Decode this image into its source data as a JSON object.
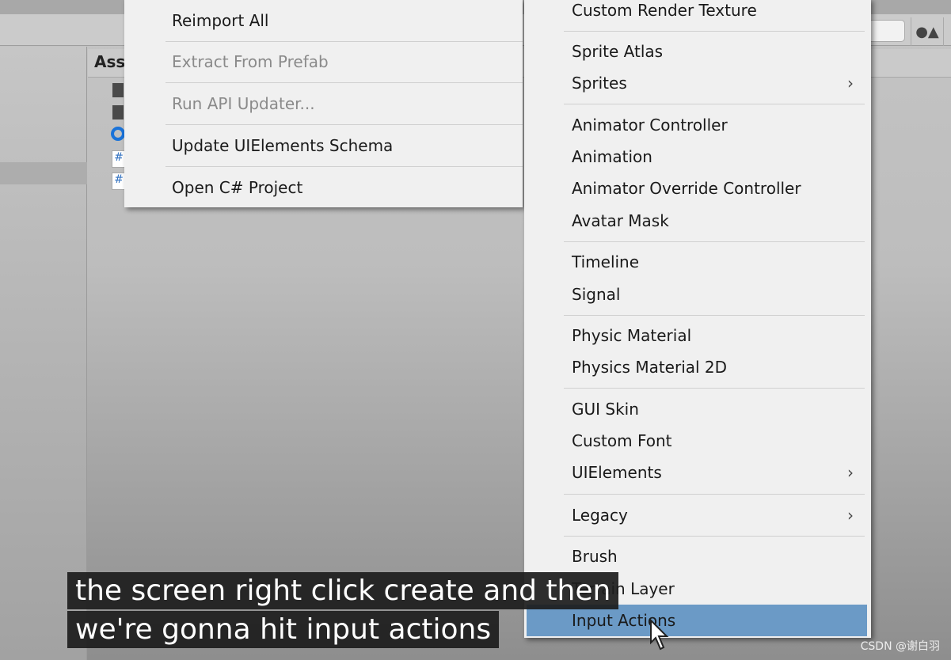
{
  "panel": {
    "assets_header": "Ass"
  },
  "left_menu": [
    {
      "label": "Reimport All",
      "disabled": false
    },
    {
      "label": "Extract From Prefab",
      "disabled": true
    },
    {
      "label": "Run API Updater...",
      "disabled": true
    },
    {
      "label": "Update UIElements Schema",
      "disabled": false
    },
    {
      "label": "Open C# Project",
      "disabled": false
    }
  ],
  "create_menu": [
    {
      "label": "Custom Render Texture"
    },
    {
      "label": "Sprite Atlas"
    },
    {
      "label": "Sprites",
      "submenu": true
    },
    {
      "label": "Animator Controller"
    },
    {
      "label": "Animation"
    },
    {
      "label": "Animator Override Controller"
    },
    {
      "label": "Avatar Mask"
    },
    {
      "label": "Timeline"
    },
    {
      "label": "Signal"
    },
    {
      "label": "Physic Material"
    },
    {
      "label": "Physics Material 2D"
    },
    {
      "label": "GUI Skin"
    },
    {
      "label": "Custom Font"
    },
    {
      "label": "UIElements",
      "submenu": true
    },
    {
      "label": "Legacy",
      "submenu": true
    },
    {
      "label": "Brush"
    },
    {
      "label": "Terrain Layer"
    },
    {
      "label": "Input Actions",
      "highlighted": true
    }
  ],
  "chevron": "›",
  "subtitles": [
    "the screen right click create and then",
    "we're gonna hit input actions"
  ],
  "watermark": "CSDN @谢白羽",
  "colors": {
    "highlight": "#6b9ac6",
    "menu_bg": "#f0f0f0"
  }
}
